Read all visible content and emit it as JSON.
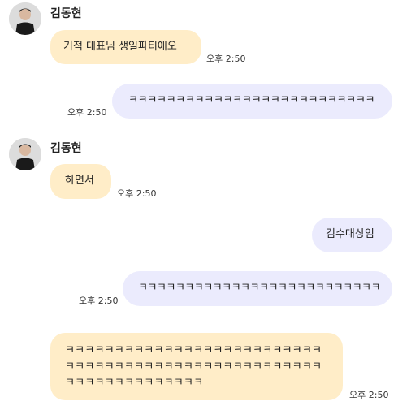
{
  "chat": {
    "sender_name": "김동현",
    "avatar_icon": "person-avatar-icon",
    "messages": [
      {
        "direction": "incoming",
        "text": "기적 대표님 생일파티애오",
        "time": "오후 2:50"
      },
      {
        "direction": "outgoing",
        "text": "ㅋㅋㅋㅋㅋㅋㅋㅋㅋㅋㅋㅋㅋㅋㅋㅋㅋㅋㅋㅋㅋㅋㅋㅋㅋㅋ",
        "time": "오후 2:50"
      },
      {
        "direction": "incoming",
        "text": "하면서",
        "time": "오후 2:50"
      },
      {
        "direction": "outgoing",
        "text": "검수대상임",
        "time": ""
      },
      {
        "direction": "outgoing",
        "text": "ㅋㅋㅋㅋㅋㅋㅋㅋㅋㅋㅋㅋㅋㅋㅋㅋㅋㅋㅋㅋㅋㅋㅋㅋㅋㅋ",
        "time": "오후 2:50"
      },
      {
        "direction": "incoming",
        "text": "ㅋㅋㅋㅋㅋㅋㅋㅋㅋㅋㅋㅋㅋㅋㅋㅋㅋㅋㅋㅋㅋㅋㅋㅋㅋㅋㅋㅋㅋㅋㅋㅋㅋㅋㅋㅋㅋㅋㅋㅋㅋㅋㅋㅋㅋㅋㅋㅋㅋㅋㅋㅋㅋㅋㅋㅋㅋㅋㅋㅋㅋㅋㅋㅋㅋㅋ",
        "time": "오후 2:50"
      }
    ]
  },
  "colors": {
    "incoming_bubble": "#ffedc8",
    "outgoing_bubble": "#ebebfd"
  }
}
